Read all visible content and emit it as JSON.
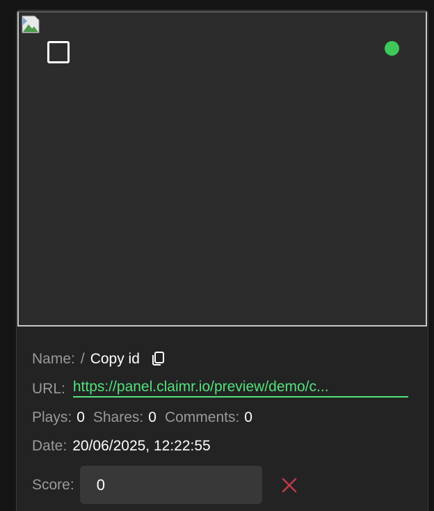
{
  "card": {
    "name_label": "Name:",
    "name_value": "/",
    "copy_label": "Copy id",
    "url_label": "URL:",
    "url_value": "https://panel.claimr.io/preview/demo/c...",
    "plays_label": "Plays:",
    "plays_value": "0",
    "shares_label": "Shares:",
    "shares_value": "0",
    "comments_label": "Comments:",
    "comments_value": "0",
    "date_label": "Date:",
    "date_value": "20/06/2025, 12:22:55",
    "score_label": "Score:",
    "score_value": "0",
    "icons": {
      "broken_image": "broken-image-icon",
      "copy": "copy-icon",
      "delete": "close-icon"
    }
  },
  "colors": {
    "status_active": "#3ec85a",
    "link": "#52e27c",
    "delete": "#c33a47"
  }
}
